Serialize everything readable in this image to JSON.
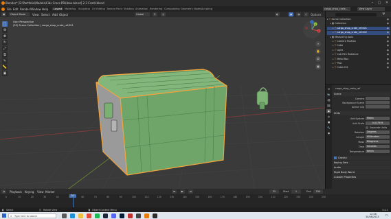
{
  "window": {
    "title": "Blender* [E:\\Portfolio\\Models\\Cibs Crocs PDL\\box.blend] 2.3 Crat4.blend",
    "controls": [
      "–",
      "▢",
      "✕"
    ]
  },
  "menubar": {
    "items": [
      "File",
      "Edit",
      "Render",
      "Window",
      "Help"
    ],
    "workspaces": [
      "Layout",
      "Modeling",
      "Sculpting",
      "UV Editing",
      "Texture Paint",
      "Shading",
      "Animation",
      "Rendering",
      "Compositing",
      "Geometry Nodes",
      "Scripting"
    ],
    "active_workspace": "Layout",
    "scene": "cargo_shop_crate...",
    "view_layer": "View Layer"
  },
  "viewport_header": {
    "mode": "Object Mode",
    "menus": [
      "View",
      "Select",
      "Add",
      "Object"
    ],
    "transform": "Global",
    "options": "Options"
  },
  "viewport": {
    "info_line1": "User Perspective",
    "info_line2": "(52) Scene Collection | cargo_shop_crate_ref.001",
    "axes": [
      "X",
      "Y",
      "Z"
    ]
  },
  "outliner": {
    "search_placeholder": "",
    "rows": [
      {
        "label": "Scene Collection",
        "indent": 0,
        "selected": false
      },
      {
        "label": "Collection",
        "indent": 1,
        "selected": false
      },
      {
        "label": "cargo_shop_crate_ref.001",
        "indent": 2,
        "selected": true
      },
      {
        "label": "cargo_shop_crate_ref.002",
        "indent": 2,
        "selected": true
      },
      {
        "label": "Measuring tools",
        "indent": 1,
        "selected": false
      },
      {
        "label": "Camera Position",
        "indent": 2,
        "selected": false
      },
      {
        "label": "Cube",
        "indent": 2,
        "selected": false
      },
      {
        "label": "Light",
        "indent": 2,
        "selected": false
      },
      {
        "label": "Cub Rim Radiance",
        "indent": 2,
        "selected": false
      },
      {
        "label": "Metal Box",
        "indent": 2,
        "selected": false
      },
      {
        "label": "Plan",
        "indent": 2,
        "selected": false
      },
      {
        "label": "Cube.001",
        "indent": 2,
        "selected": false
      }
    ]
  },
  "properties": {
    "object_name": "cargo_shop_crate_ref",
    "scene_section": "Scene",
    "camera_label": "Camera",
    "bg_scene_label": "Background Scene",
    "active_clip_label": "Active Clip",
    "units_section": "Units",
    "unit_system_label": "Unit System",
    "unit_system_value": "Metric",
    "unit_scale_label": "Unit Scale",
    "unit_scale_value": "0.017939",
    "separate_units_label": "Separate Units",
    "rotation_label": "Rotation",
    "rotation_value": "Degrees",
    "length_label": "Length",
    "length_value": "Millimeters",
    "mass_label": "Mass",
    "mass_value": "Kilograms",
    "time_label": "Time",
    "time_value": "Seconds",
    "temperature_label": "Temperature",
    "temperature_value": "Kelvin",
    "collapsed_sections": [
      "Gravity",
      "Keying Sets",
      "Audio",
      "Rigid Body World",
      "Custom Properties"
    ]
  },
  "timeline": {
    "menus": [
      "Playback",
      "Keying",
      "View",
      "Marker"
    ],
    "current_frame": "52",
    "start_label": "Start",
    "start": "1",
    "end_label": "End",
    "end": "250",
    "ticks": [
      "0",
      "10",
      "20",
      "30",
      "40",
      "50",
      "60",
      "70",
      "80",
      "90",
      "100",
      "110",
      "120",
      "130",
      "140",
      "150",
      "160",
      "170",
      "180",
      "190",
      "200",
      "210",
      "220",
      "230",
      "240",
      "250"
    ]
  },
  "statusbar": {
    "select": "Select",
    "rotate": "Rotate View",
    "context": "Object Context Menu",
    "version": "3.4.1"
  },
  "taskbar": {
    "search": "Type here to search",
    "time": "12:08",
    "date": "30/08/2023"
  },
  "colors": {
    "selection_outline": "#f5a33c",
    "mesh_green": "#78b072",
    "active_blue": "#4772b3"
  }
}
